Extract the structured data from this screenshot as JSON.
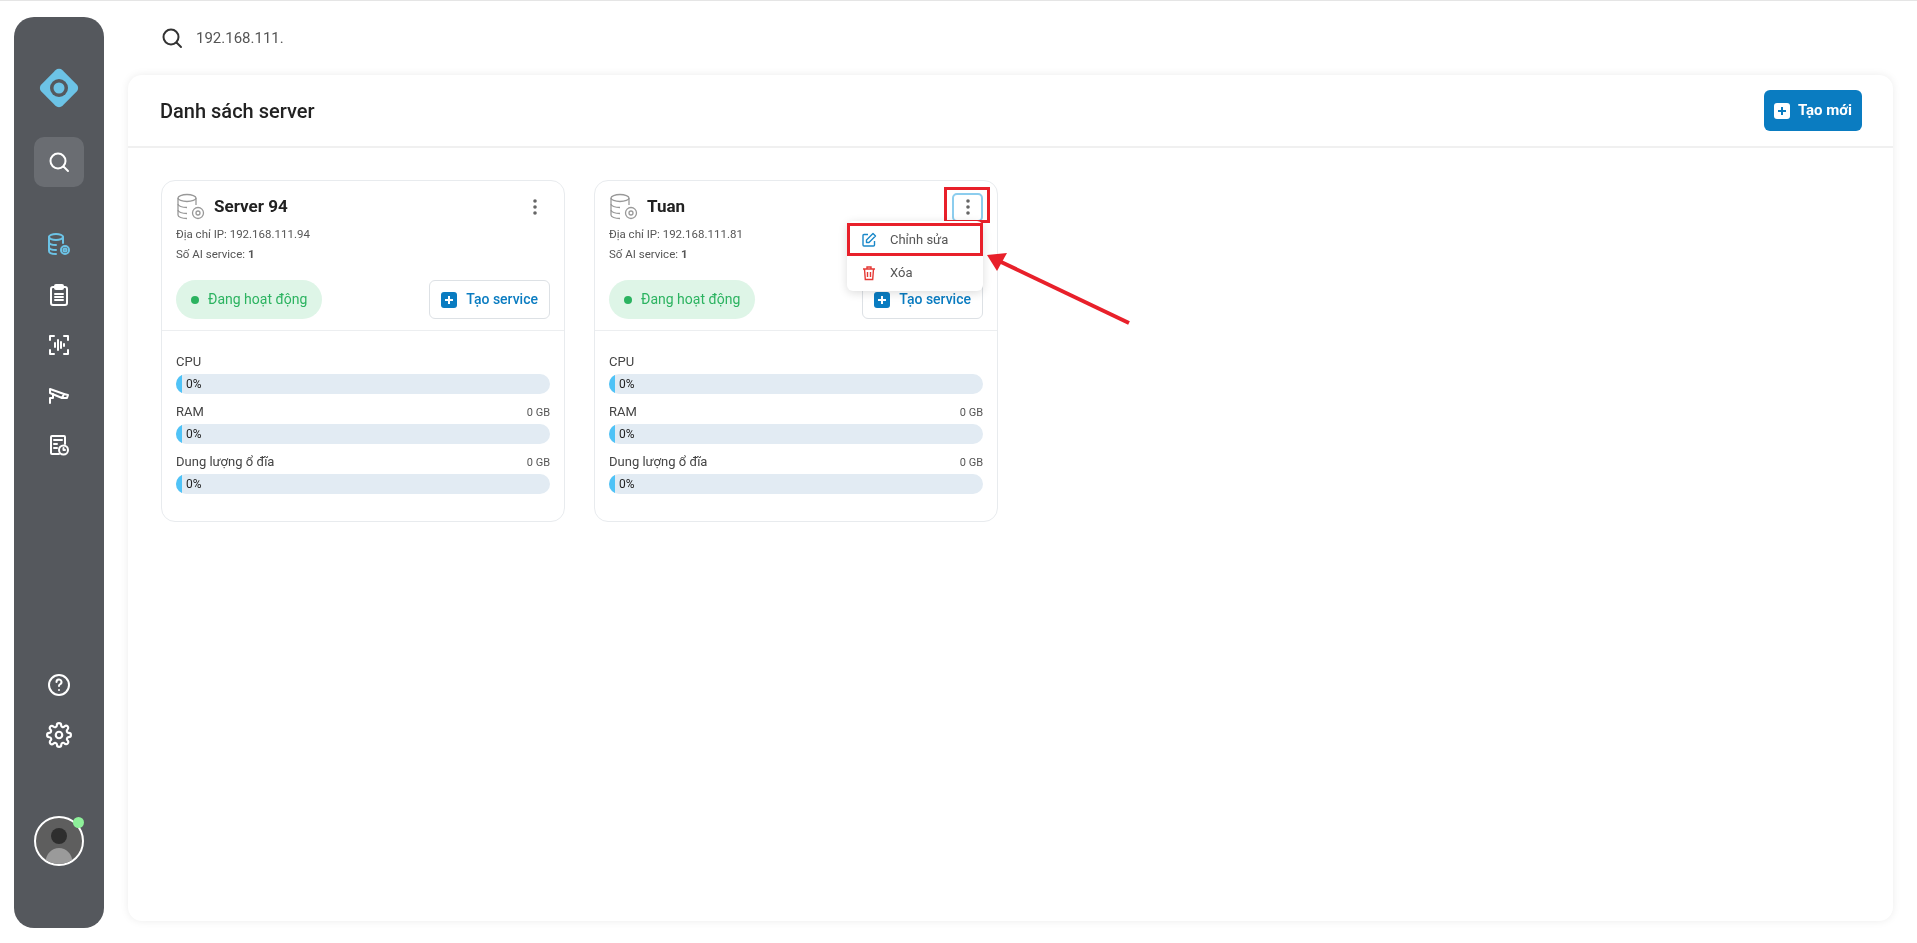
{
  "search": {
    "value": "192.168.111."
  },
  "sidebar": {
    "items": [
      {
        "kind": "search",
        "selected": false,
        "hovered": true
      },
      {
        "kind": "servers",
        "selected": true,
        "hovered": false
      },
      {
        "kind": "clipboard",
        "selected": false,
        "hovered": false
      },
      {
        "kind": "scan",
        "selected": false,
        "hovered": false
      },
      {
        "kind": "camera",
        "selected": false,
        "hovered": false
      },
      {
        "kind": "report",
        "selected": false,
        "hovered": false
      }
    ],
    "bottom_items": [
      {
        "kind": "help"
      },
      {
        "kind": "settings"
      }
    ],
    "user": {
      "online": true
    }
  },
  "panel": {
    "title": "Danh sách server",
    "create_button": "Tạo mới"
  },
  "cards": [
    {
      "name": "Server 94",
      "ip": "Địa chỉ IP: 192.168.111.94",
      "ai_services": "Số AI service: **1**",
      "status": "Đang hoạt động",
      "create_service": "Tạo service",
      "menu_button": {
        "focused": false,
        "highlighted": false
      },
      "metrics": [
        {
          "label": "CPU",
          "level": 0,
          "reading": "0%"
        },
        {
          "label": "RAM",
          "amount": "0 GB",
          "level": 0,
          "reading": "0%"
        },
        {
          "label": "Dung lượng ổ đĩa",
          "amount": "0 GB",
          "level": 0,
          "reading": "0%"
        }
      ]
    },
    {
      "name": "Tuan",
      "ip": "Địa chỉ IP: 192.168.111.81",
      "ai_services": "Số AI service: **1**",
      "status": "Đang hoạt động",
      "create_service": "Tạo service",
      "menu_button": {
        "focused": true,
        "highlighted": true
      },
      "menu": [
        {
          "kind": "edit",
          "label": "Chỉnh sửa",
          "highlighted": true
        },
        {
          "kind": "delete",
          "label": "Xóa",
          "highlighted": false
        }
      ],
      "annotation_arrow": true,
      "metrics": [
        {
          "label": "CPU",
          "level": 0,
          "reading": "0%"
        },
        {
          "label": "RAM",
          "amount": "0 GB",
          "level": 0,
          "reading": "0%"
        },
        {
          "label": "Dung lượng ổ đĩa",
          "amount": "0 GB",
          "level": 0,
          "reading": "0%"
        }
      ]
    }
  ]
}
